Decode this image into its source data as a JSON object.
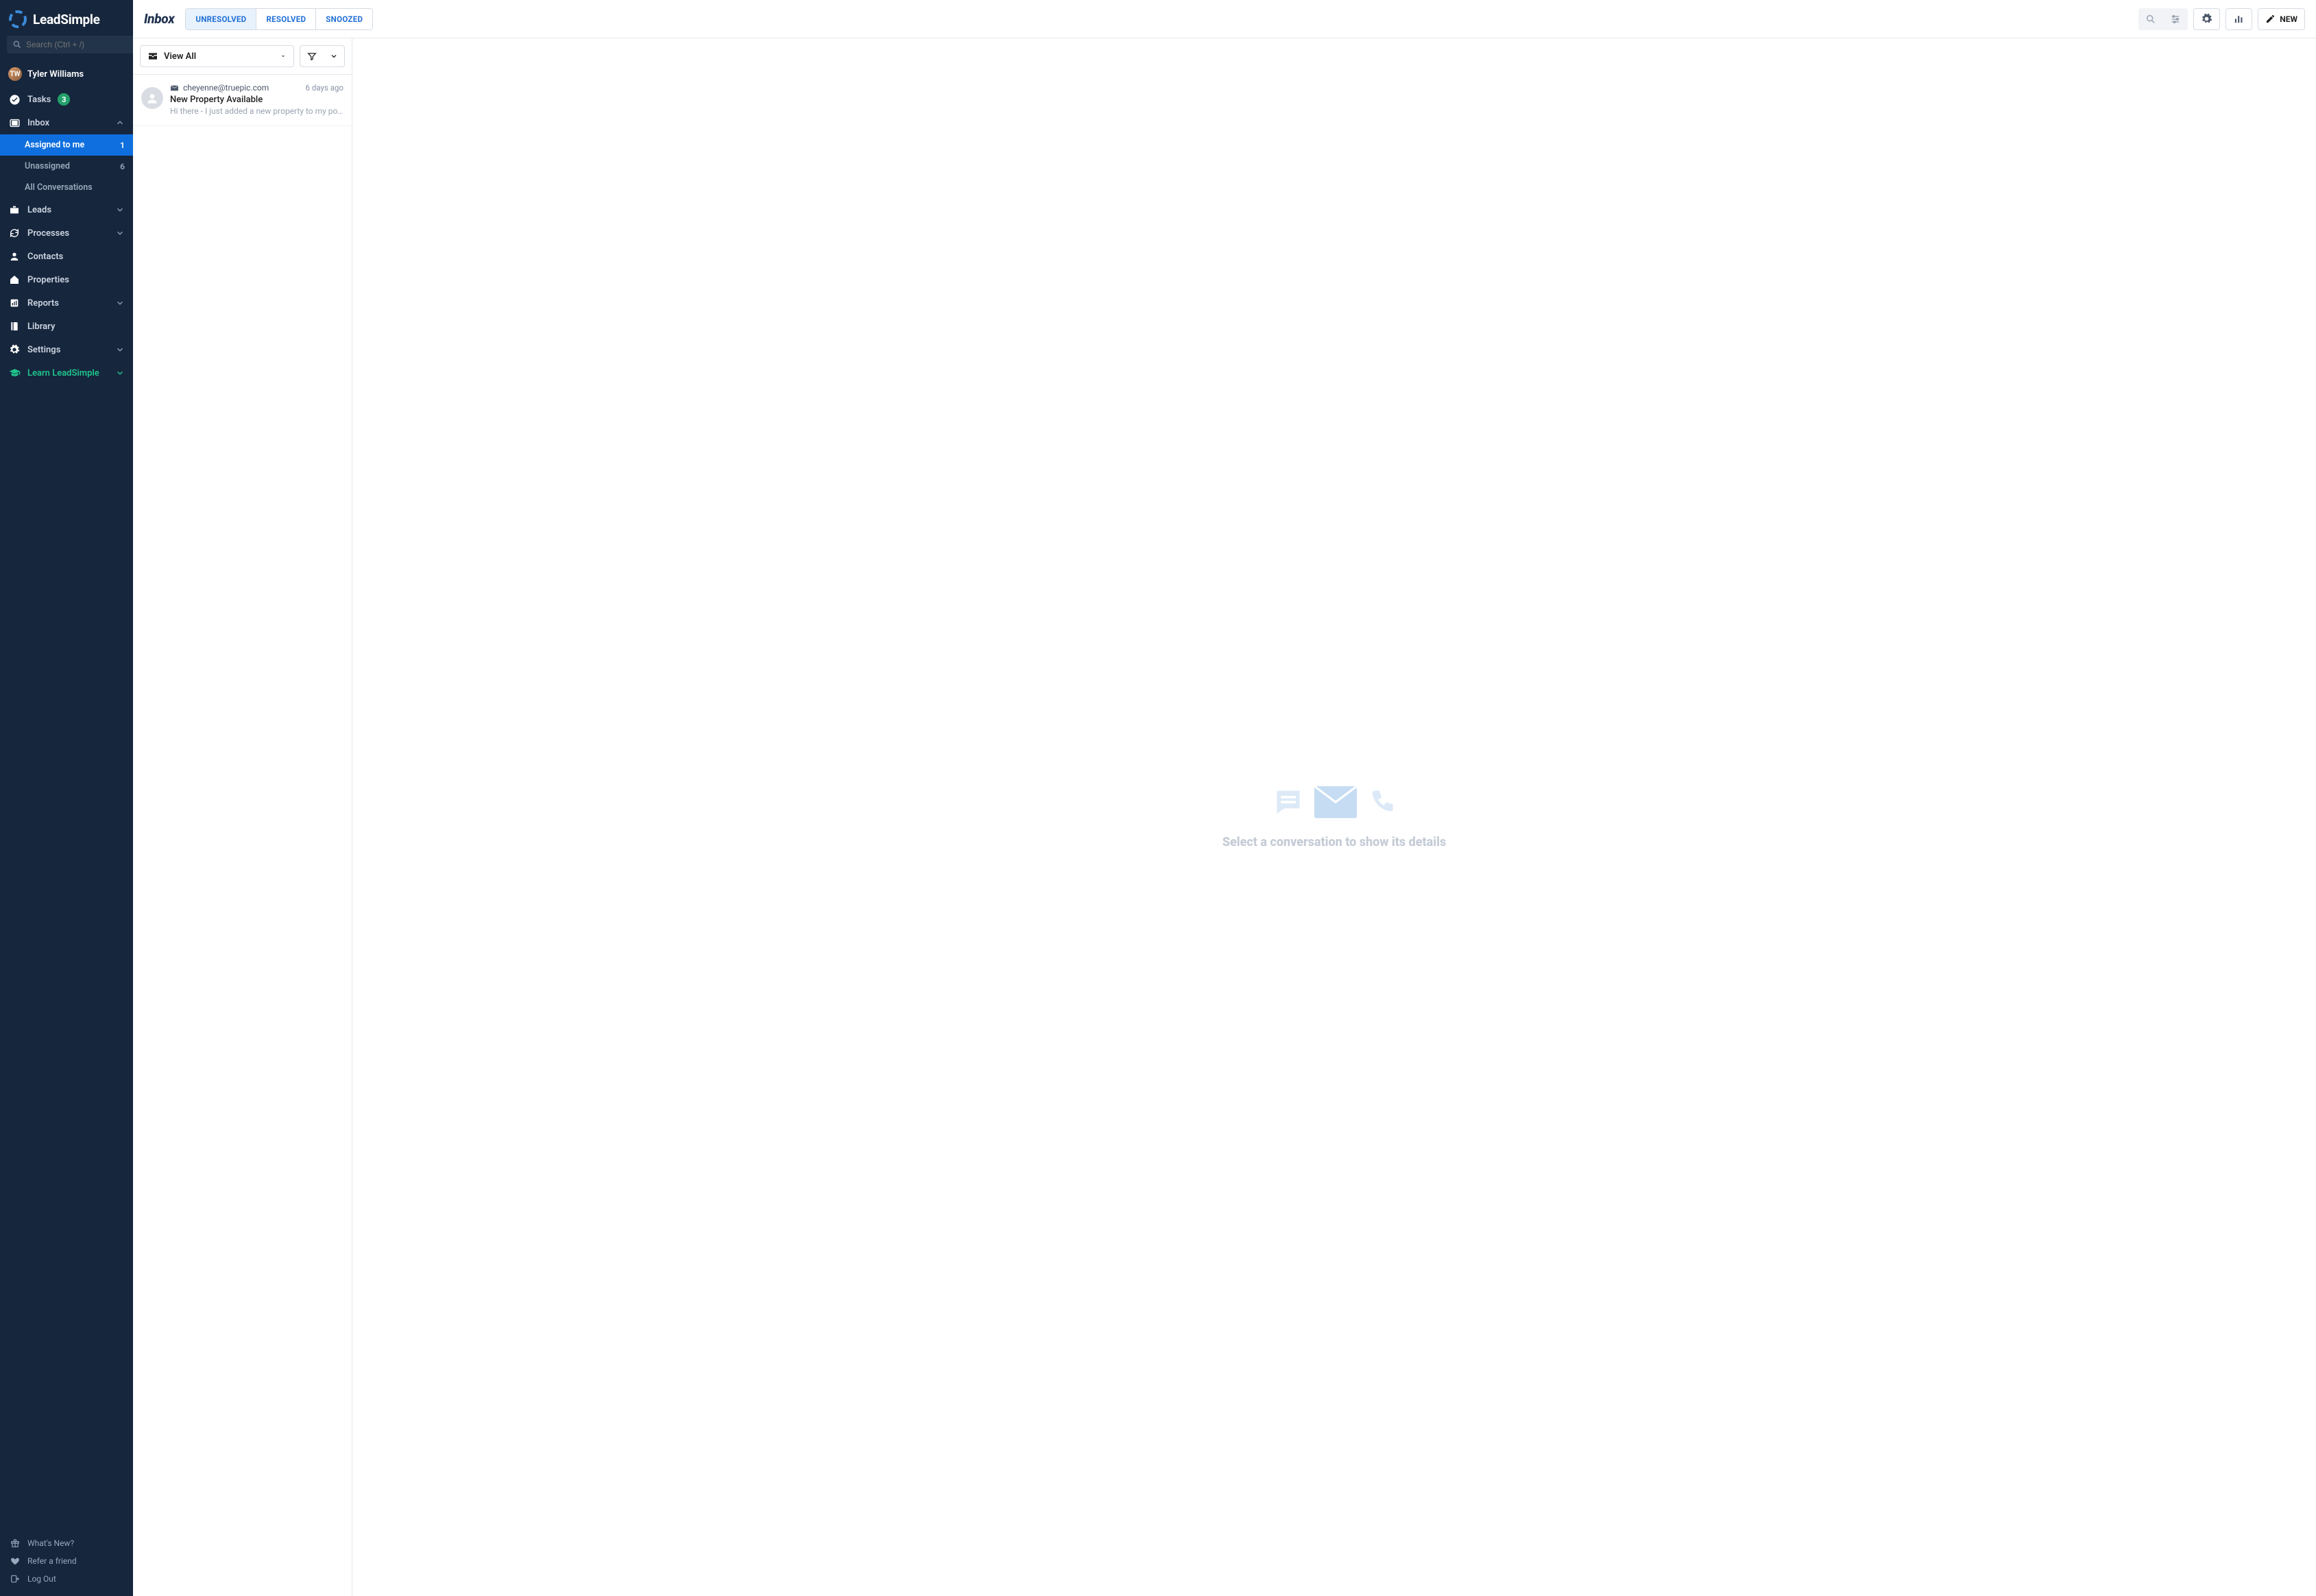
{
  "brand": {
    "name": "LeadSimple"
  },
  "search": {
    "placeholder": "Search (Ctrl + /)"
  },
  "user": {
    "name": "Tyler Williams",
    "initials": "TW"
  },
  "nav": {
    "tasks": {
      "label": "Tasks",
      "badge": "3"
    },
    "inbox": {
      "label": "Inbox",
      "sub": {
        "assigned": {
          "label": "Assigned to me",
          "count": "1"
        },
        "unassigned": {
          "label": "Unassigned",
          "count": "6"
        },
        "all": {
          "label": "All Conversations"
        }
      }
    },
    "leads": {
      "label": "Leads"
    },
    "processes": {
      "label": "Processes"
    },
    "contacts": {
      "label": "Contacts"
    },
    "properties": {
      "label": "Properties"
    },
    "reports": {
      "label": "Reports"
    },
    "library": {
      "label": "Library"
    },
    "settings": {
      "label": "Settings"
    },
    "learn": {
      "label": "Learn LeadSimple"
    }
  },
  "footer": {
    "whatsnew": "What's New?",
    "refer": "Refer a friend",
    "logout": "Log Out"
  },
  "header": {
    "title": "Inbox",
    "tabs": {
      "unresolved": "UNRESOLVED",
      "resolved": "RESOLVED",
      "snoozed": "SNOOZED"
    },
    "new_label": "NEW"
  },
  "list": {
    "view_all": "View All",
    "items": [
      {
        "from": "cheyenne@truepic.com",
        "subject": "New Property Available",
        "preview": "Hi there - I just added a new property to my po...",
        "time": "6 days ago"
      }
    ]
  },
  "empty": {
    "text": "Select a conversation to show its details"
  }
}
